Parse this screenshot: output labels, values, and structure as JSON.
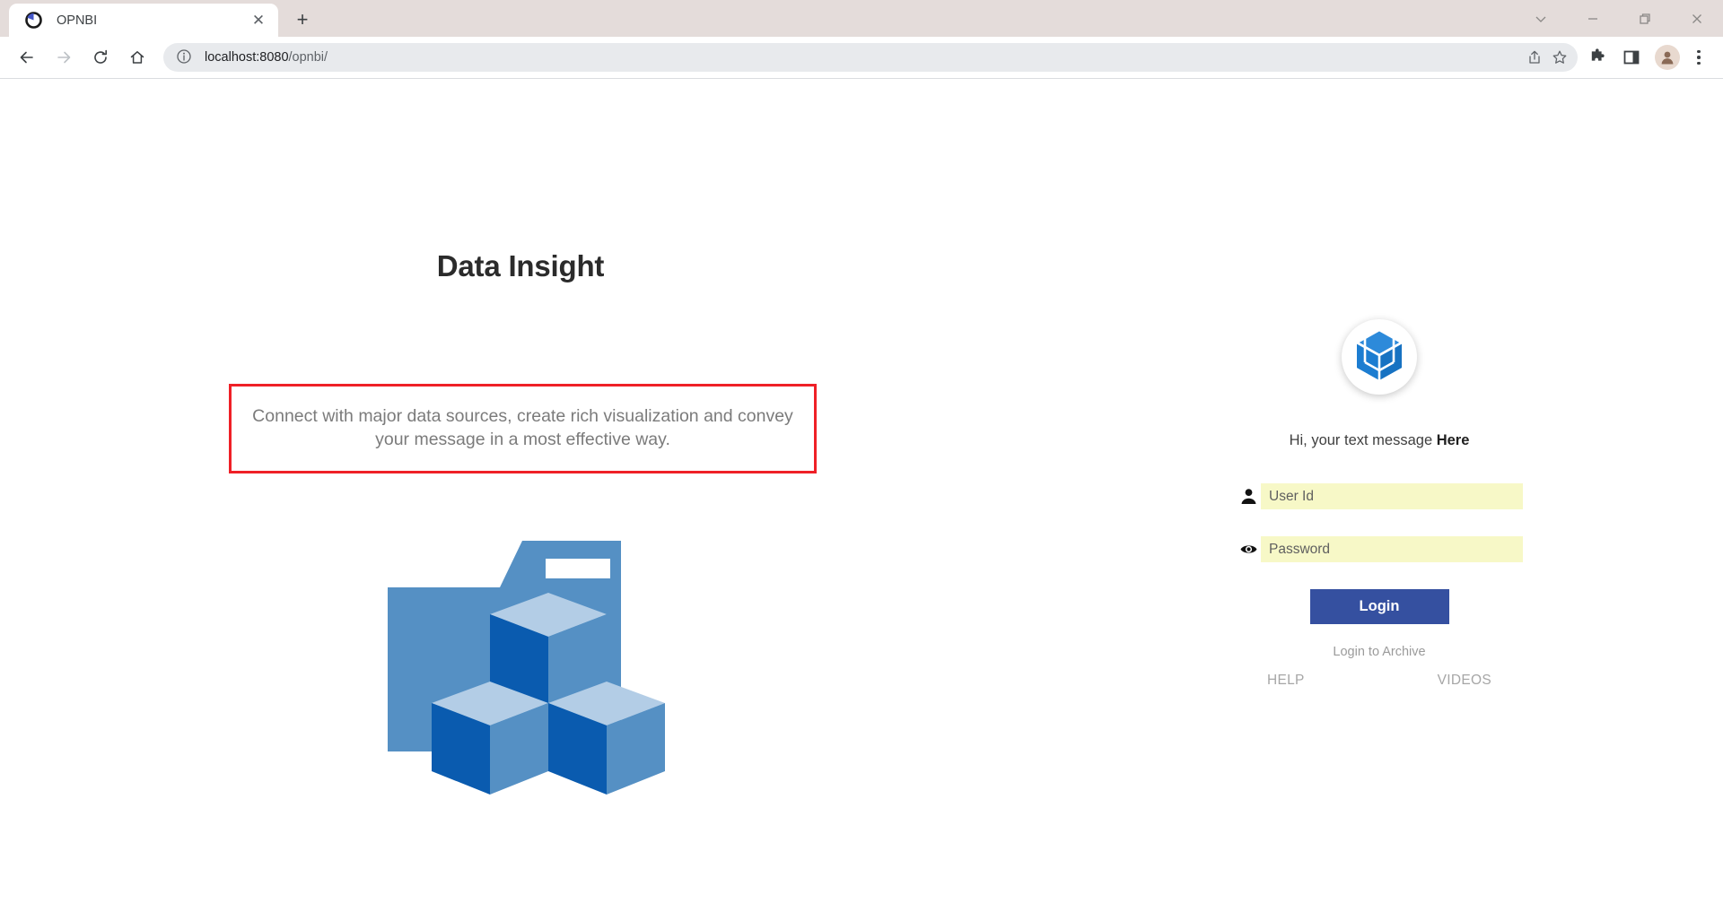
{
  "browser": {
    "tab": {
      "title": "OPNBI",
      "favicon": "pie-chart-icon",
      "close_label": "✕"
    },
    "new_tab_label": "+",
    "window_controls": {
      "chevron": "∨",
      "minimize": "—",
      "maximize": "❐",
      "close": "✕"
    },
    "nav": {
      "back": "back-arrow-icon",
      "forward": "forward-arrow-icon",
      "reload": "reload-icon",
      "home": "home-icon"
    },
    "omnibox": {
      "info_icon": "site-info-icon",
      "host": "localhost:8080",
      "path": "/opnbi/",
      "url_full": "localhost:8080/opnbi/",
      "share_icon": "share-icon",
      "bookmark_icon": "star-icon"
    },
    "toolbar_icons": {
      "extensions": "puzzle-icon",
      "side_panel": "side-panel-icon",
      "profile": "profile-avatar-icon",
      "menu": "kebab-menu-icon"
    }
  },
  "page": {
    "title": "Data Insight",
    "tagline": "Connect with major data sources, create rich visualization and convey your message in a most effective way.",
    "annotation_color": "#ef2027",
    "illustration": {
      "name": "folder-with-blue-cubes-illustration",
      "folder_color": "#5590c4",
      "cube_top_color": "#b3cde6",
      "cube_left_color": "#0a5baf",
      "cube_right_color": "#5590c4"
    }
  },
  "login": {
    "logo": "blue-isometric-cube-logo",
    "logo_color": "#1c7dd1",
    "greeting_prefix": "Hi, your text message ",
    "greeting_highlight": "Here",
    "fields": [
      {
        "name": "user-id",
        "icon": "person-icon",
        "placeholder": "User Id",
        "value": ""
      },
      {
        "name": "password",
        "icon": "eye-icon",
        "placeholder": "Password",
        "value": ""
      }
    ],
    "submit_label": "Login",
    "submit_color": "#3550a0",
    "archive_link": "Login to Archive",
    "help_link": "HELP",
    "videos_link": "VIDEOS"
  }
}
